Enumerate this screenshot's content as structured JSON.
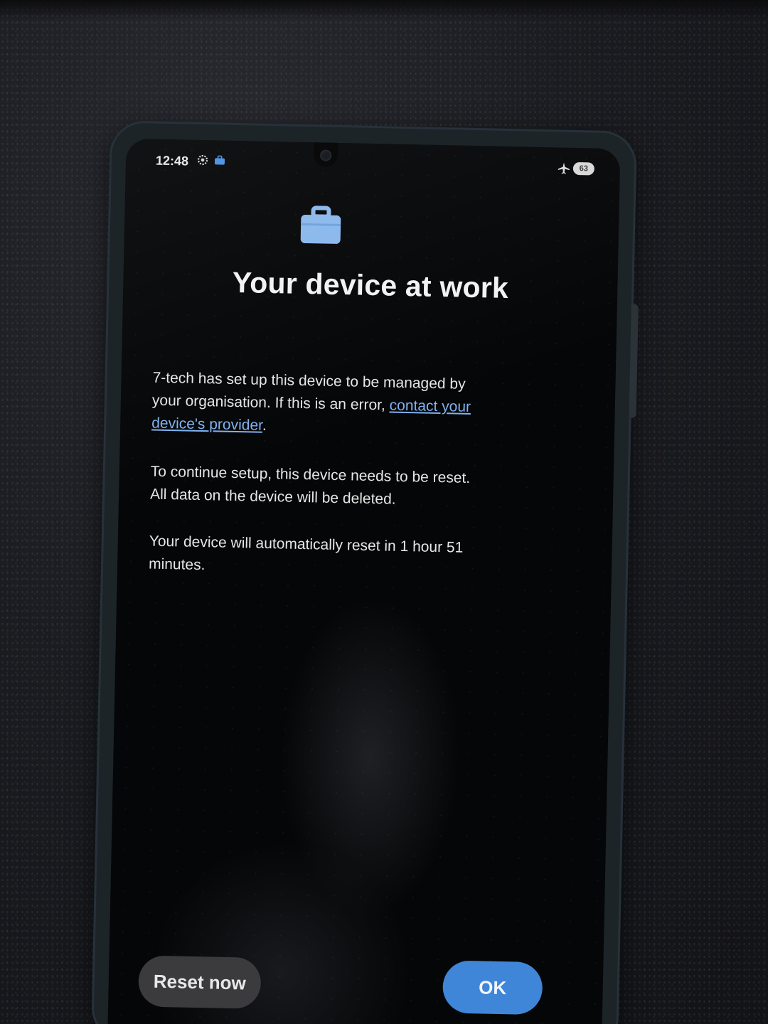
{
  "status_bar": {
    "time": "12:48",
    "battery_level": "63",
    "icons": [
      "gear-icon",
      "work-icon",
      "airplane-icon",
      "battery-icon"
    ]
  },
  "dialog": {
    "icon": "briefcase-icon",
    "title": "Your device at work",
    "paragraph1_prefix": "7-tech has set up this device to be managed by your organisation. If this is an error, ",
    "paragraph1_link": "contact your device's provider",
    "paragraph1_suffix": ".",
    "paragraph2": "To continue setup, this device needs to be reset. All data on the device will be deleted.",
    "paragraph3": "Your device will automatically reset in 1 hour 51 minutes."
  },
  "buttons": {
    "reset_label": "Reset now",
    "ok_label": "OK"
  },
  "colors": {
    "accent": "#3f86d8",
    "link": "#7fb2f0",
    "icon": "#8ab8ec"
  }
}
